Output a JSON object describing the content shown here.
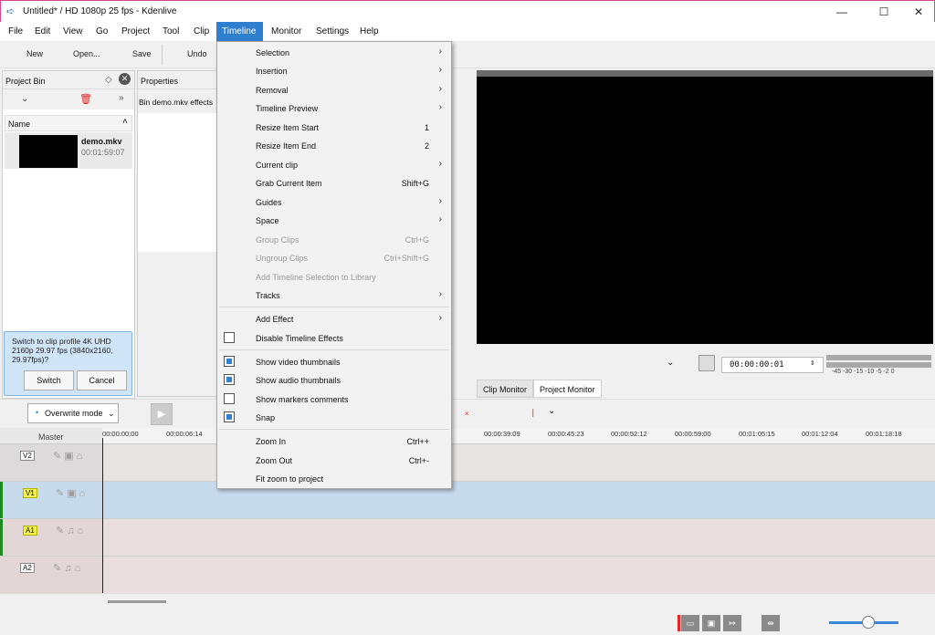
{
  "window": {
    "title": "Untitled* / HD 1080p 25 fps - Kdenlive"
  },
  "menubar": [
    "File",
    "Edit",
    "View",
    "Go",
    "Project",
    "Tool",
    "Clip",
    "Timeline",
    "Monitor",
    "Settings",
    "Help"
  ],
  "toolbar": {
    "new": "New",
    "open": "Open...",
    "save": "Save",
    "undo": "Undo"
  },
  "bin": {
    "title": "Project Bin",
    "column": "Name",
    "clip_name": "demo.mkv",
    "clip_duration": "00:01:59:07",
    "switch_msg": "Switch to clip profile 4K UHD 2160p 29.97 fps (3840x2160, 29.97fps)?",
    "switch_label": "Switch",
    "cancel_label": "Cancel"
  },
  "properties": {
    "title": "Properties",
    "subtitle": "Bin demo.mkv effects"
  },
  "monitor": {
    "timecode": "00:00:00:01",
    "meter_scale": "-45 -30 -15 -10 -5 -2 0",
    "tab_clip": "Clip Monitor",
    "tab_project": "Project Monitor"
  },
  "edit": {
    "mode": "Overwrite mode"
  },
  "timeline": {
    "master": "Master",
    "ticks": [
      "00:00:00:00",
      "00:00:06:14",
      "00:00:39:09",
      "00:00:45:23",
      "00:00:52:12",
      "00:00:59:00",
      "00:01:05:15",
      "00:01:12:04",
      "00:01:18:18"
    ],
    "tracks": [
      "V2",
      "V1",
      "A1",
      "A2"
    ]
  },
  "dropdown": {
    "selection": "Selection",
    "insertion": "Insertion",
    "removal": "Removal",
    "timeline_preview": "Timeline Preview",
    "resize_start": "Resize Item Start",
    "resize_start_sc": "1",
    "resize_end": "Resize Item End",
    "resize_end_sc": "2",
    "current_clip": "Current clip",
    "grab_item": "Grab Current Item",
    "grab_item_sc": "Shift+G",
    "guides": "Guides",
    "space": "Space",
    "group": "Group Clips",
    "group_sc": "Ctrl+G",
    "ungroup": "Ungroup Clips",
    "ungroup_sc": "Ctrl+Shift+G",
    "add_selection_lib": "Add Timeline Selection to Library",
    "tracks": "Tracks",
    "add_effect": "Add Effect",
    "disable_effects": "Disable Timeline Effects",
    "show_video_thumbs": "Show video thumbnails",
    "show_audio_thumbs": "Show audio thumbnails",
    "show_markers": "Show markers comments",
    "snap": "Snap",
    "zoom_in": "Zoom In",
    "zoom_in_sc": "Ctrl++",
    "zoom_out": "Zoom Out",
    "zoom_out_sc": "Ctrl+-",
    "fit_zoom": "Fit zoom to project"
  },
  "colors": {
    "accent": "#2f7fd0",
    "v1_track": "#c8dbed",
    "audio_track": "#eadfe0"
  }
}
